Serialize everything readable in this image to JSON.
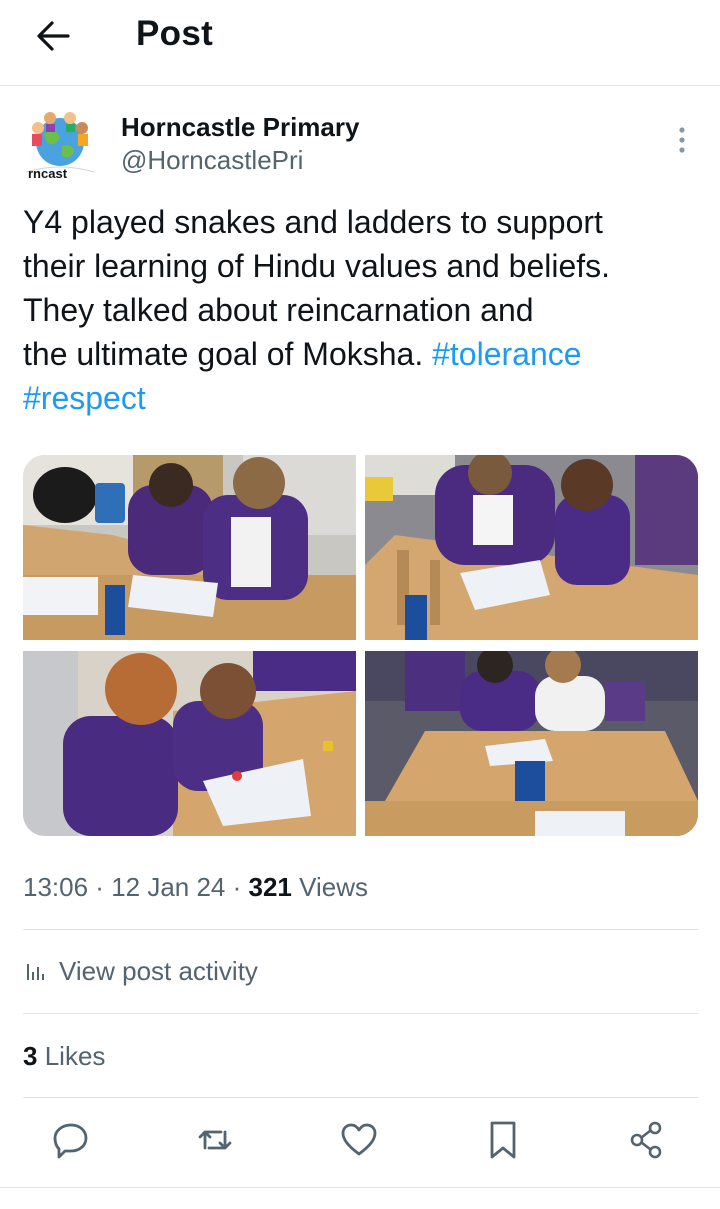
{
  "header": {
    "title": "Post",
    "back_icon": "arrow-left-icon"
  },
  "author": {
    "name": "Horncastle Primary",
    "handle": "@HorncastlePri",
    "avatar_text": "rncast"
  },
  "tweet": {
    "text_line1": "Y4 played snakes and ladders to support",
    "text_line2": "their learning of Hindu values and beliefs.",
    "text_line3": "They talked about reincarnation and",
    "text_line4": "the ultimate goal of Moksha.",
    "hashtag1": "#tolerance",
    "hashtag2": "#respect"
  },
  "meta": {
    "time": "13:06",
    "sep1": " · ",
    "date": "12 Jan 24",
    "sep2": " · ",
    "views_count": "321",
    "views_label": "Views"
  },
  "activity": {
    "label": "View post activity"
  },
  "likes": {
    "count": "3",
    "label": "Likes"
  },
  "actions": [
    "reply-icon",
    "repost-icon",
    "like-icon",
    "bookmark-icon",
    "share-icon"
  ],
  "colors": {
    "accent": "#1d9bf0",
    "text": "#0f1419",
    "secondary": "#536471",
    "divider": "#e1e5e8"
  }
}
